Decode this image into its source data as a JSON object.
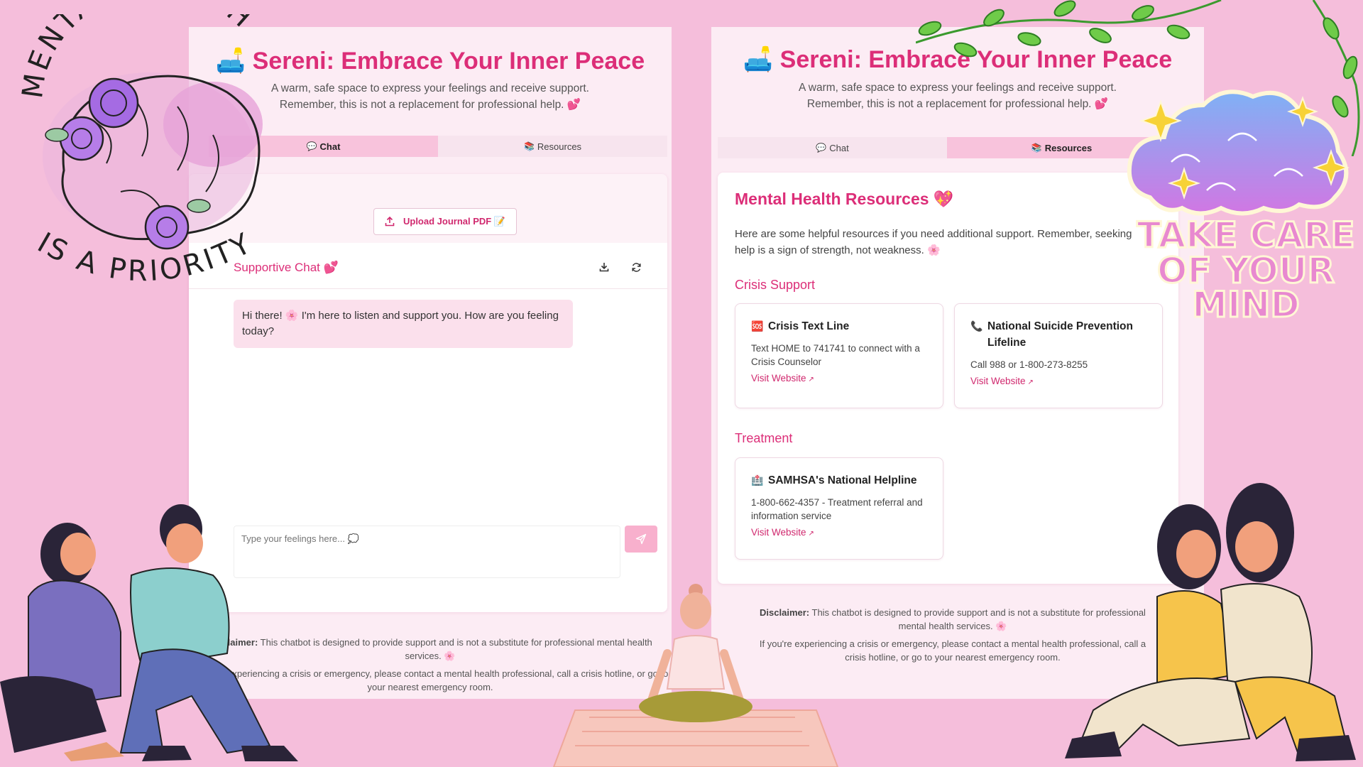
{
  "theme": {
    "background": "#f5bedb",
    "panel": "#fcecf4",
    "accent": "#dc2e78",
    "tab_active": "#f8c3dc",
    "bubble": "#fbe0ec"
  },
  "left_app": {
    "title_emoji": "🛋️",
    "title": "Sereni: Embrace Your Inner Peace",
    "subtitle_line1": "A warm, safe space to express your feelings and receive support.",
    "subtitle_line2": "Remember, this is not a replacement for professional help. 💕",
    "tabs": [
      {
        "icon": "💬",
        "label": "Chat",
        "active": true
      },
      {
        "icon": "📚",
        "label": "Resources",
        "active": false
      }
    ],
    "upload_label": "Upload Journal PDF 📝",
    "chat_title": "Supportive Chat 💕",
    "message": "Hi there! 🌸 I'm here to listen and support you. How are you feeling today?",
    "input_placeholder": "Type your feelings here... 💭",
    "disclaimer_bold": "Disclaimer:",
    "disclaimer_text": " This chatbot is designed to provide support and is not a substitute for professional mental health services. 🌸",
    "disclaimer_crisis": "If you're experiencing a crisis or emergency, please contact a mental health professional, call a crisis hotline, or go to your nearest emergency room."
  },
  "right_app": {
    "title_emoji": "🛋️",
    "title": "Sereni: Embrace Your Inner Peace",
    "subtitle_line1": "A warm, safe space to express your feelings and receive support.",
    "subtitle_line2": "Remember, this is not a replacement for professional help. 💕",
    "tabs": [
      {
        "icon": "💬",
        "label": "Chat",
        "active": false
      },
      {
        "icon": "📚",
        "label": "Resources",
        "active": true
      }
    ],
    "resources_title": "Mental Health Resources 💖",
    "resources_intro": "Here are some helpful resources if you need additional support. Remember, seeking help is a sign of strength, not weakness. 🌸",
    "sections": [
      {
        "heading": "Crisis Support",
        "cards": [
          {
            "icon": "🆘",
            "title": "Crisis Text Line",
            "desc": "Text HOME to 741741 to connect with a Crisis Counselor",
            "link": "Visit Website"
          },
          {
            "icon": "📞",
            "title": "National Suicide Prevention Lifeline",
            "desc": "Call 988 or 1-800-273-8255",
            "link": "Visit Website"
          }
        ]
      },
      {
        "heading": "Treatment",
        "cards": [
          {
            "icon": "🏥",
            "title": "SAMHSA's National Helpline",
            "desc": "1-800-662-4357 - Treatment referral and information service",
            "link": "Visit Website"
          }
        ]
      }
    ],
    "disclaimer_bold": "Disclaimer:",
    "disclaimer_text": " This chatbot is designed to provide support and is not a substitute for professional mental health services. 🌸",
    "disclaimer_crisis": "If you're experiencing a crisis or emergency, please contact a mental health professional, call a crisis hotline, or go to your nearest emergency room."
  },
  "stickers": {
    "mental_health_badge": "MENTAL HEALTH IS A PRIORITY",
    "take_care": "TAKE CARE OF YOUR MIND"
  }
}
